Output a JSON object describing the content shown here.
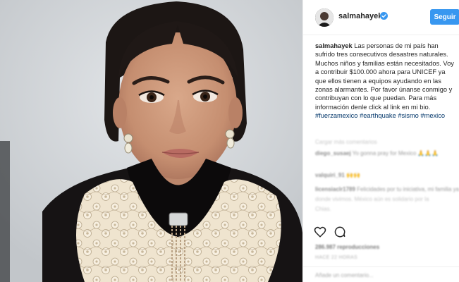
{
  "post": {
    "username": "salmahayek",
    "follow_label": "Seguir",
    "caption_user": "salmahayek",
    "caption_text": "Las personas de mi país han sufrido tres consecutivos desastres naturales. Muchos niños y familias están necesitados. Voy a contribuir $100.000 ahora para UNICEF ya que ellos tienen a equipos ayudando en las zonas alarmantes. Por favor únanse conmigo y contribuyan con lo que puedan. Para más información denle click al link en mi bio.",
    "hashtags": [
      "#fuerzamexico",
      "#earthquake",
      "#sismo",
      "#mexico"
    ],
    "load_more": "Cargar más comentarios",
    "comments": [
      {
        "user": "diego_susaej",
        "text": "Yo gonna pray for Mexico 🙏🙏🙏"
      },
      {
        "user": "valquiri_91",
        "text": "🙌🙌"
      },
      {
        "user": "licensiaclr1789",
        "text": "Felicidades por tu iniciativa, mi familia ya bu"
      },
      {
        "user": "",
        "text": "donde vivimos. México aún es solidario por la"
      },
      {
        "user": "",
        "text": "Chias."
      }
    ],
    "likes": "286.987 reproducciones",
    "date": "HACE 22 HORAS",
    "comment_placeholder": "Añade un comentario..."
  },
  "colors": {
    "accent": "#3897f0",
    "hashtag": "#003569",
    "text": "#262626",
    "border": "#efefef"
  },
  "icons": [
    "verified-badge-icon",
    "heart-icon",
    "comment-icon"
  ]
}
